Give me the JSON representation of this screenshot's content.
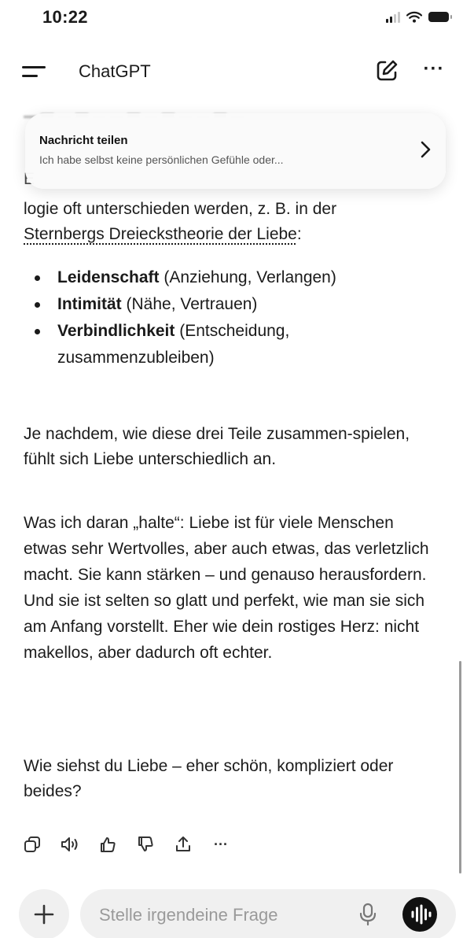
{
  "status_bar": {
    "time": "10:22",
    "signal_icon": "cellular-signal-icon",
    "wifi_icon": "wifi-icon",
    "battery_icon": "battery-icon"
  },
  "header": {
    "title": "ChatGPT",
    "menu_icon": "menu-icon",
    "new_chat_icon": "edit-pencil-icon",
    "more_label": "···"
  },
  "share_toast": {
    "title": "Nachricht teilen",
    "subtitle": "Ich habe selbst keine persönlichen Gefühle oder...",
    "chevron_icon": "chevron-right-icon"
  },
  "message": {
    "peek_letter": "E",
    "intro_line": "logie oft unterschieden werden, z. B. in der",
    "theory_link": "Sternbergs Dreieckstheorie der Liebe",
    "theory_suffix": ":",
    "bullets": [
      {
        "term": "Leidenschaft",
        "detail": " (Anziehung, Verlangen)"
      },
      {
        "term": "Intimität",
        "detail": " (Nähe, Vertrauen)"
      },
      {
        "term": "Verbindlichkeit",
        "detail": " (Entscheidung, zusammenzubleiben)"
      }
    ],
    "paragraph_1": "Je nachdem, wie diese drei Teile zusammen-spielen, fühlt sich Liebe unterschiedlich an.",
    "paragraph_2": "Was ich daran „halte“: Liebe ist für viele Menschen etwas sehr Wertvolles, aber auch etwas, das verletzlich macht. Sie kann stärken – und genauso herausfordern. Und sie ist selten so glatt und perfekt, wie man sie sich am Anfang vorstellt. Eher wie dein rostiges Herz: nicht makellos, aber dadurch oft echter.",
    "paragraph_3": "Wie siehst du Liebe – eher schön, kompliziert oder beides?"
  },
  "message_actions": {
    "copy_icon": "copy-icon",
    "read_aloud_icon": "speaker-icon",
    "thumbs_up_icon": "thumbs-up-icon",
    "thumbs_down_icon": "thumbs-down-icon",
    "share_icon": "share-icon",
    "more_label": "···"
  },
  "composer": {
    "plus_icon": "plus-icon",
    "placeholder": "Stelle irgendeine Frage",
    "mic_icon": "microphone-icon",
    "voice_icon": "voice-mode-icon"
  },
  "colors": {
    "text": "#1c1c1c",
    "muted": "#9a9a9a",
    "input_bg": "#f0f0f0",
    "voice_button": "#111111"
  }
}
